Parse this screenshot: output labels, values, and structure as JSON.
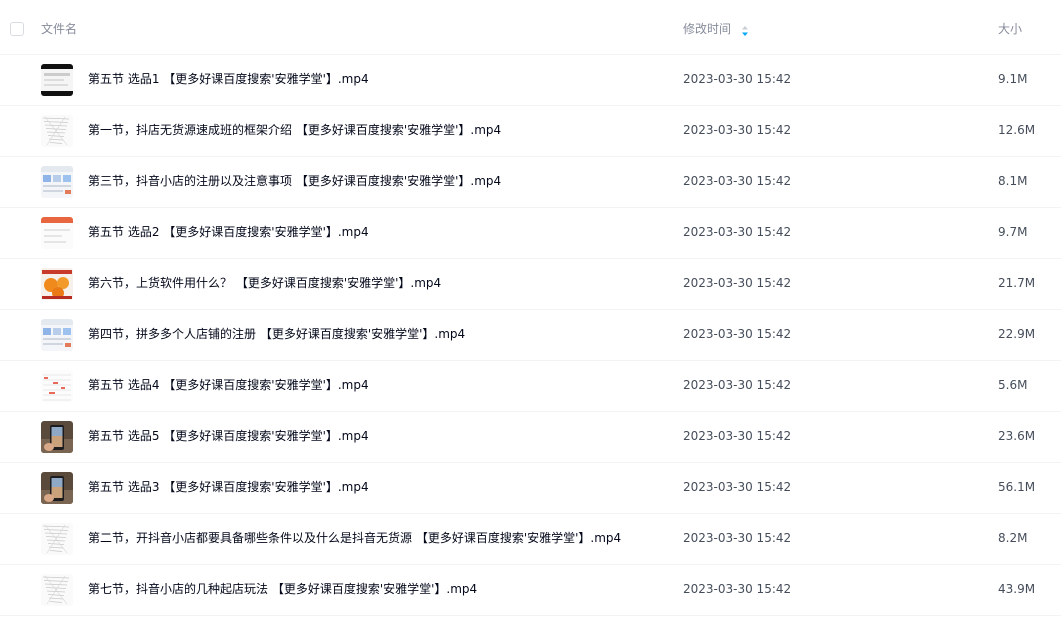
{
  "header": {
    "name_label": "文件名",
    "time_label": "修改时间",
    "size_label": "大小",
    "sort_icon": "sort-descending-icon",
    "sort_color": "#06a7ff"
  },
  "files": [
    {
      "name": "第五节 选品1 【更多好课百度搜索'安雅学堂'】.mp4",
      "time": "2023-03-30 15:42",
      "size": "9.1M",
      "thumb": "dark-video-thumbnail"
    },
    {
      "name": "第一节，抖店无货源速成班的框架介绍 【更多好课百度搜索'安雅学堂'】.mp4",
      "time": "2023-03-30 15:42",
      "size": "12.6M",
      "thumb": "document-thumbnail"
    },
    {
      "name": "第三节，抖音小店的注册以及注意事项 【更多好课百度搜索'安雅学堂'】.mp4",
      "time": "2023-03-30 15:42",
      "size": "8.1M",
      "thumb": "webpage-thumbnail"
    },
    {
      "name": "第五节 选品2 【更多好课百度搜索'安雅学堂'】.mp4",
      "time": "2023-03-30 15:42",
      "size": "9.7M",
      "thumb": "orange-header-thumbnail"
    },
    {
      "name": "第六节，上货软件用什么？ 【更多好课百度搜索'安雅学堂'】.mp4",
      "time": "2023-03-30 15:42",
      "size": "21.7M",
      "thumb": "oranges-thumbnail"
    },
    {
      "name": "第四节，拼多多个人店铺的注册 【更多好课百度搜索'安雅学堂'】.mp4",
      "time": "2023-03-30 15:42",
      "size": "22.9M",
      "thumb": "webpage-thumbnail"
    },
    {
      "name": "第五节 选品4 【更多好课百度搜索'安雅学堂'】.mp4",
      "time": "2023-03-30 15:42",
      "size": "5.6M",
      "thumb": "spreadsheet-thumbnail"
    },
    {
      "name": "第五节 选品5 【更多好课百度搜索'安雅学堂'】.mp4",
      "time": "2023-03-30 15:42",
      "size": "23.6M",
      "thumb": "phone-thumbnail"
    },
    {
      "name": "第五节 选品3 【更多好课百度搜索'安雅学堂'】.mp4",
      "time": "2023-03-30 15:42",
      "size": "56.1M",
      "thumb": "phone-thumbnail"
    },
    {
      "name": "第二节，开抖音小店都要具备哪些条件以及什么是抖音无货源 【更多好课百度搜索'安雅学堂'】.mp4",
      "time": "2023-03-30 15:42",
      "size": "8.2M",
      "thumb": "document-thumbnail"
    },
    {
      "name": "第七节，抖音小店的几种起店玩法 【更多好课百度搜索'安雅学堂'】.mp4",
      "time": "2023-03-30 15:42",
      "size": "43.9M",
      "thumb": "document-thumbnail"
    }
  ]
}
